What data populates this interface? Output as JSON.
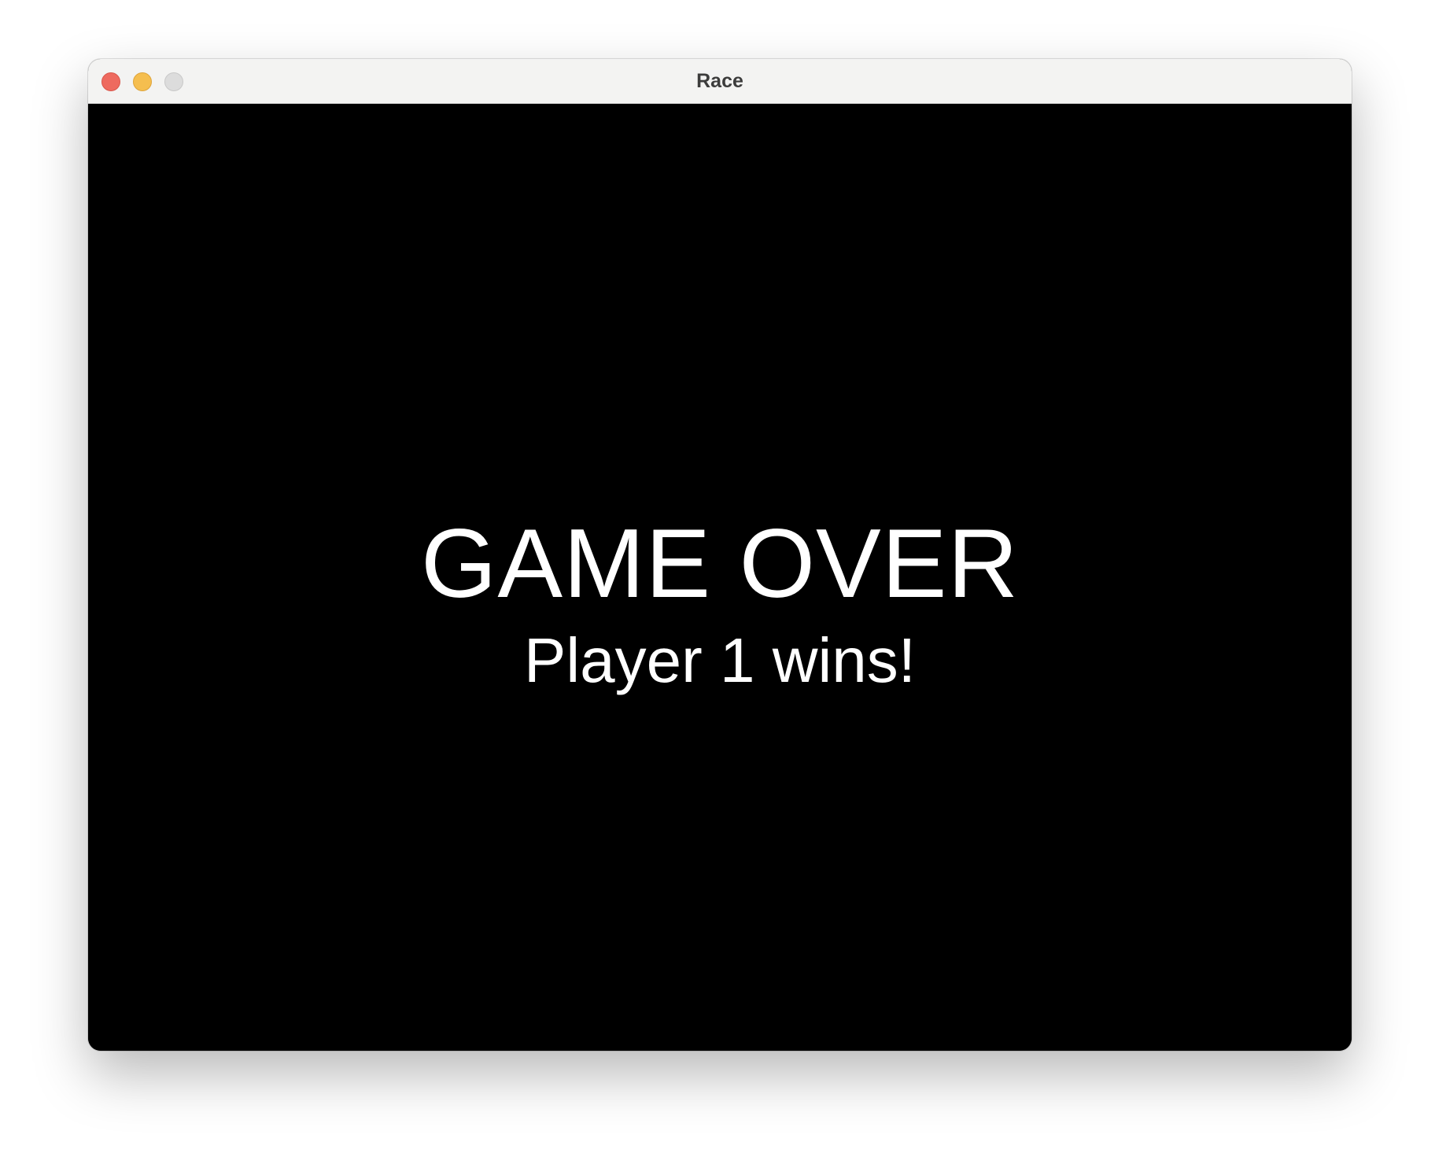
{
  "window": {
    "title": "Race",
    "controls": {
      "close_color": "#ee6a5f",
      "minimize_color": "#f5be4f",
      "zoom_color": "#dcdcdc"
    }
  },
  "game": {
    "background_color": "#000000",
    "text_color": "#ffffff",
    "heading": "GAME OVER",
    "result": "Player 1 wins!"
  }
}
